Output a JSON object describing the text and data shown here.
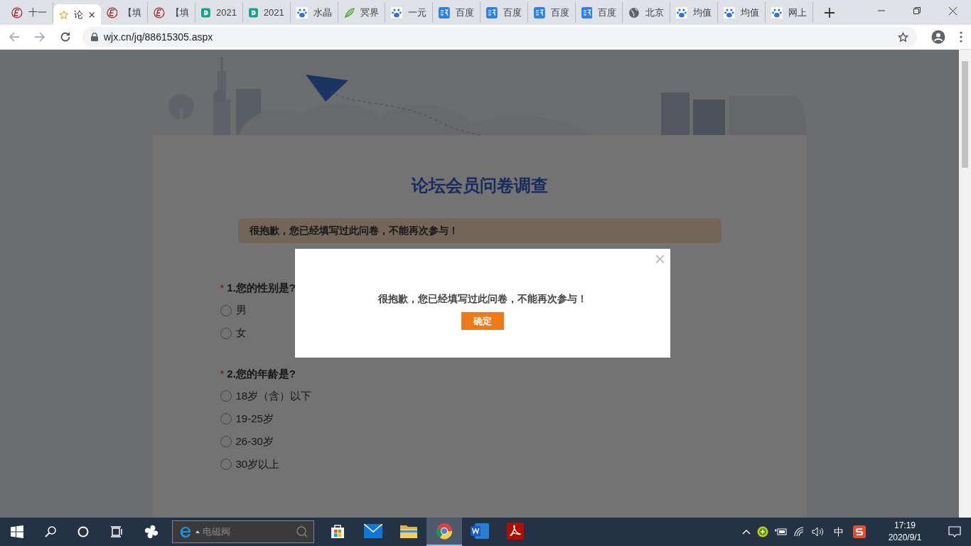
{
  "browser": {
    "tabs": [
      {
        "title": "十一",
        "kind": "e-logo",
        "selected": false
      },
      {
        "title": "论",
        "kind": "star",
        "selected": true
      },
      {
        "title": "【填",
        "kind": "e-logo",
        "selected": false
      },
      {
        "title": "【填",
        "kind": "e-logo",
        "selected": false
      },
      {
        "title": "2021",
        "kind": "d-logo",
        "selected": false
      },
      {
        "title": "2021",
        "kind": "d-logo",
        "selected": false
      },
      {
        "title": "水晶",
        "kind": "paw",
        "selected": false
      },
      {
        "title": "冥界",
        "kind": "leaf",
        "selected": false
      },
      {
        "title": "一元",
        "kind": "paw",
        "selected": false
      },
      {
        "title": "百度",
        "kind": "translate",
        "selected": false
      },
      {
        "title": "百度",
        "kind": "translate",
        "selected": false
      },
      {
        "title": "百度",
        "kind": "translate",
        "selected": false
      },
      {
        "title": "百度",
        "kind": "translate",
        "selected": false
      },
      {
        "title": "北京",
        "kind": "globe",
        "selected": false
      },
      {
        "title": "均值",
        "kind": "paw",
        "selected": false
      },
      {
        "title": "均值",
        "kind": "paw",
        "selected": false
      },
      {
        "title": "网上",
        "kind": "paw",
        "selected": false
      }
    ],
    "address": "wjx.cn/jq/88615305.aspx"
  },
  "survey": {
    "title": "论坛会员问卷调查",
    "notice": "很抱歉，您已经填写过此问卷，不能再次参与！",
    "questions": [
      {
        "marker": "*",
        "title": "1.您的性别是?",
        "options": [
          {
            "label": "男",
            "selected": false
          },
          {
            "label": "女",
            "selected": false
          }
        ]
      },
      {
        "marker": "*",
        "title": "2.您的年龄是?",
        "options": [
          {
            "label": "18岁（含）以下",
            "selected": false
          },
          {
            "label": "19-25岁",
            "selected": false
          },
          {
            "label": "26-30岁",
            "selected": false
          },
          {
            "label": "30岁以上",
            "selected": false
          }
        ]
      }
    ]
  },
  "dialog": {
    "message": "很抱歉，您已经填写过此问卷，不能再次参与！",
    "button": "确定"
  },
  "taskbar": {
    "search_placeholder": "电磁阀",
    "apps": [
      {
        "kind": "store",
        "active": false
      },
      {
        "kind": "mail",
        "active": false
      },
      {
        "kind": "folder",
        "active": false
      },
      {
        "kind": "chrome",
        "active": true
      },
      {
        "kind": "word",
        "active": false
      },
      {
        "kind": "pdf",
        "active": false
      }
    ],
    "ime": "中",
    "time": "17:19",
    "date": "2020/9/1"
  }
}
